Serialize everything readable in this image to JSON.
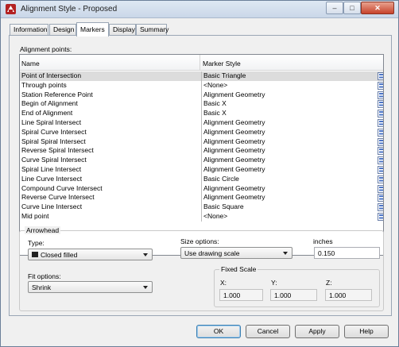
{
  "window": {
    "title": "Alignment Style - Proposed",
    "controls": {
      "minimize": "–",
      "maximize": "□",
      "close": "✕"
    }
  },
  "tabs": [
    {
      "label": "Information"
    },
    {
      "label": "Design"
    },
    {
      "label": "Markers"
    },
    {
      "label": "Display"
    },
    {
      "label": "Summary"
    }
  ],
  "active_tab": "Markers",
  "alignment_points": {
    "section_label": "Alignment points:",
    "columns": {
      "name": "Name",
      "marker_style": "Marker Style"
    },
    "rows": [
      {
        "name": "Point of Intersection",
        "style": "Basic Triangle"
      },
      {
        "name": "Through points",
        "style": "<None>"
      },
      {
        "name": "Station Reference Point",
        "style": "Alignment Geometry"
      },
      {
        "name": "Begin of Alignment",
        "style": "Basic X"
      },
      {
        "name": "End of Alignment",
        "style": "Basic X"
      },
      {
        "name": "Line Spiral Intersect",
        "style": "Alignment Geometry"
      },
      {
        "name": "Spiral Curve Intersect",
        "style": "Alignment Geometry"
      },
      {
        "name": "Spiral Spiral Intersect",
        "style": "Alignment Geometry"
      },
      {
        "name": "Reverse Spiral Intersect",
        "style": "Alignment Geometry"
      },
      {
        "name": "Curve Spiral Intersect",
        "style": "Alignment Geometry"
      },
      {
        "name": "Spiral Line Intersect",
        "style": "Alignment Geometry"
      },
      {
        "name": "Line Curve Intersect",
        "style": "Basic Circle"
      },
      {
        "name": "Compound Curve Intersect",
        "style": "Alignment Geometry"
      },
      {
        "name": "Reverse Curve Intersect",
        "style": "Alignment Geometry"
      },
      {
        "name": "Curve Line Intersect",
        "style": "Basic Square"
      },
      {
        "name": "Mid point",
        "style": "<None>"
      }
    ]
  },
  "arrowhead": {
    "group_label": "Arrowhead",
    "type_label": "Type:",
    "type_value": "Closed filled",
    "size_options_label": "Size options:",
    "size_options_value": "Use drawing scale",
    "units_label": "inches",
    "size_value": "0.150",
    "fit_options_label": "Fit options:",
    "fit_options_value": "Shrink",
    "fixed_scale": {
      "label": "Fixed Scale",
      "x_label": "X:",
      "x_value": "1.000",
      "y_label": "Y:",
      "y_value": "1.000",
      "z_label": "Z:",
      "z_value": "1.000"
    }
  },
  "buttons": {
    "ok": "OK",
    "cancel": "Cancel",
    "apply": "Apply",
    "help": "Help"
  }
}
